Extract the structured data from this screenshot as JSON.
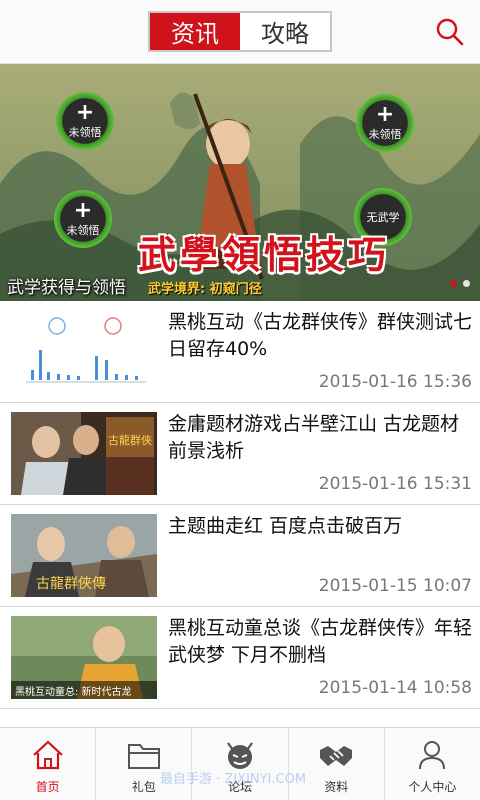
{
  "header": {
    "tabs": [
      {
        "label": "资讯",
        "active": true
      },
      {
        "label": "攻略",
        "active": false
      }
    ],
    "search_icon": "search-icon",
    "accent_color": "#d0121b"
  },
  "banner": {
    "caption": "武学获得与领悟",
    "headline": "武學領悟技巧",
    "subline": "武学境界: 初窥门径",
    "badges": [
      "未领悟",
      "未领悟",
      "未领悟",
      "无武学"
    ],
    "slide_count": 2,
    "active_slide": 0
  },
  "news": [
    {
      "title": "黑桃互动《古龙群侠传》群侠测试七日留存40%",
      "date": "2015-01-16 15:36"
    },
    {
      "title": "金庸题材游戏占半壁江山 古龙题材前景浅析",
      "date": "2015-01-16 15:31"
    },
    {
      "title": "主题曲走红 百度点击破百万",
      "date": "2015-01-15 10:07"
    },
    {
      "title": "黑桃互动童总谈《古龙群侠传》年轻武侠梦 下月不删档",
      "date": "2015-01-14 10:58",
      "thumb_caption": "黑桃互动童总: 新时代古龙"
    }
  ],
  "bottom_nav": [
    {
      "label": "首页",
      "icon": "home-icon",
      "active": true
    },
    {
      "label": "礼包",
      "icon": "folder-icon",
      "active": false
    },
    {
      "label": "论坛",
      "icon": "devil-face-icon",
      "active": false
    },
    {
      "label": "资料",
      "icon": "handshake-icon",
      "active": false
    },
    {
      "label": "个人中心",
      "icon": "person-icon",
      "active": false
    }
  ],
  "watermark": "最自手游 · ZIXINYI.COM"
}
